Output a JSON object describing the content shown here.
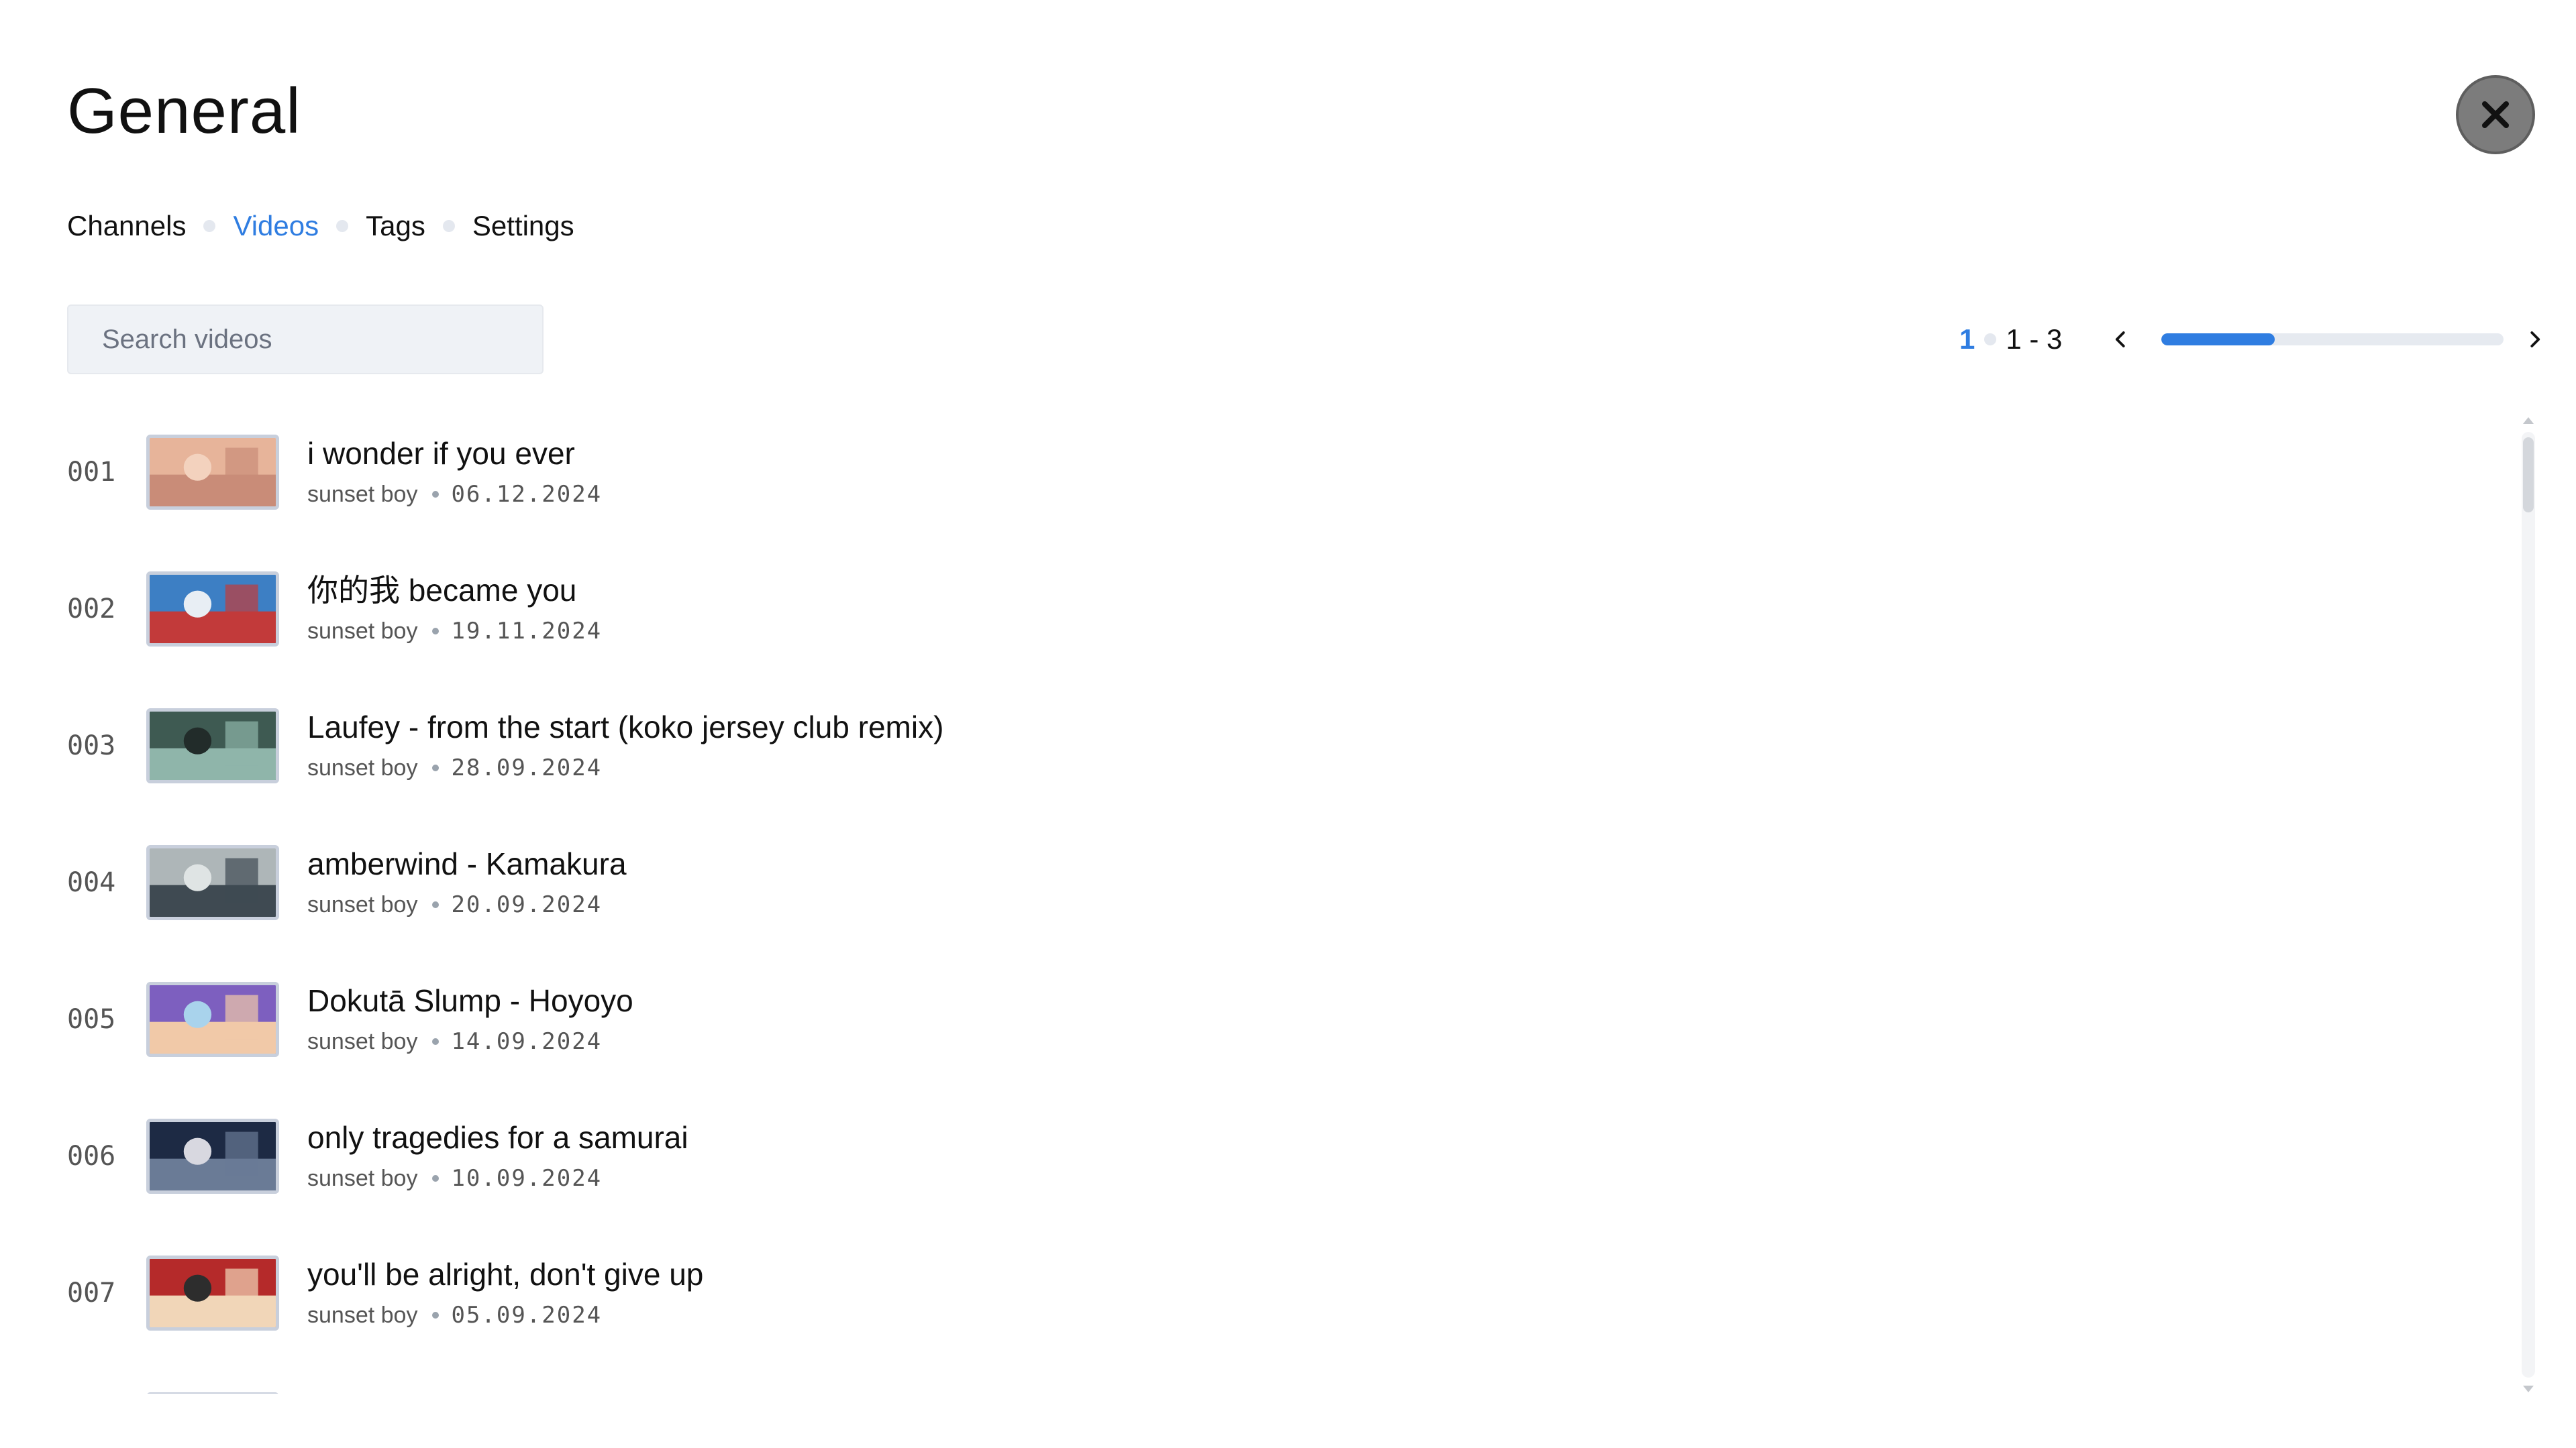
{
  "header": {
    "title": "General"
  },
  "tabs": [
    {
      "label": "Channels",
      "active": false
    },
    {
      "label": "Videos",
      "active": true
    },
    {
      "label": "Tags",
      "active": false
    },
    {
      "label": "Settings",
      "active": false
    }
  ],
  "search": {
    "placeholder": "Search videos",
    "value": ""
  },
  "pagination": {
    "current_page": "1",
    "range": "1 - 3",
    "progress_fraction": 0.33
  },
  "videos": [
    {
      "index": "001",
      "title": "i wonder if you ever",
      "channel": "sunset boy",
      "date": "06.12.2024",
      "thumb_colors": [
        "#e7b49a",
        "#c98c78",
        "#f3d2be"
      ]
    },
    {
      "index": "002",
      "title": "你的我 became you",
      "channel": "sunset boy",
      "date": "19.11.2024",
      "thumb_colors": [
        "#3d7fc4",
        "#c23a3a",
        "#e8eef4"
      ]
    },
    {
      "index": "003",
      "title": "Laufey - from the start (koko jersey club remix)",
      "channel": "sunset boy",
      "date": "28.09.2024",
      "thumb_colors": [
        "#3e5a52",
        "#8fb5aa",
        "#222c2a"
      ]
    },
    {
      "index": "004",
      "title": "amberwind - Kamakura",
      "channel": "sunset boy",
      "date": "20.09.2024",
      "thumb_colors": [
        "#aeb6b8",
        "#3f4a52",
        "#dfe4e4"
      ]
    },
    {
      "index": "005",
      "title": "Dokutā Slump - Hoyoyo",
      "channel": "sunset boy",
      "date": "14.09.2024",
      "thumb_colors": [
        "#7d5fbf",
        "#f1c9a8",
        "#a9d3ec"
      ]
    },
    {
      "index": "006",
      "title": "only tragedies for a samurai",
      "channel": "sunset boy",
      "date": "10.09.2024",
      "thumb_colors": [
        "#1d2a44",
        "#6a7b96",
        "#d8d8e0"
      ]
    },
    {
      "index": "007",
      "title": "you'll be alright, don't give up",
      "channel": "sunset boy",
      "date": "05.09.2024",
      "thumb_colors": [
        "#b52a2a",
        "#f1d6b8",
        "#2d2d2d"
      ]
    }
  ],
  "scrollbar": {
    "position_fraction": 0.0
  }
}
